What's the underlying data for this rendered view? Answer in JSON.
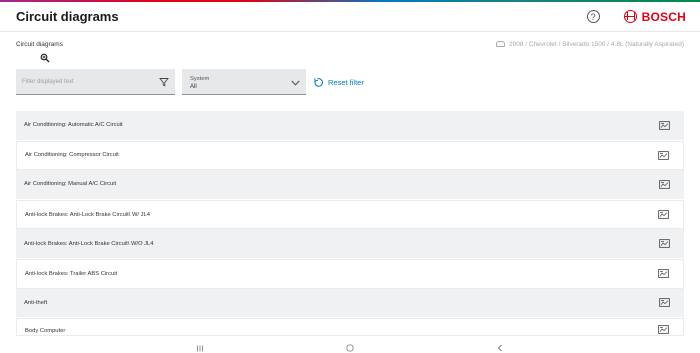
{
  "header": {
    "title": "Circuit diagrams",
    "help_glyph": "?",
    "brand": "BOSCH",
    "brand_color": "#e20015"
  },
  "breadcrumb": "Circuit diagrams",
  "vehicle": {
    "icon": "car-icon",
    "text": "2008 / Chevrolet / Silverado 1500 / 4.8L (Naturally Aspirated)"
  },
  "filter": {
    "placeholder": "Filter displayed text",
    "icon": "funnel-icon"
  },
  "system_select": {
    "label": "System",
    "value": "All"
  },
  "reset_filter": {
    "label": "Reset filter",
    "color": "#007bc0"
  },
  "diagrams": [
    {
      "label": "Air Conditioning: Automatic A/C Circuit"
    },
    {
      "label": "Air Conditioning: Compressor Circuit"
    },
    {
      "label": "Air Conditioning: Manual A/C Circuit"
    },
    {
      "label": "Anti-lock Brakes: Anti-Lock Brake Circuit\\ W/ JL4"
    },
    {
      "label": "Anti-lock Brakes: Anti-Lock Brake Circuit\\ W/O JL4"
    },
    {
      "label": "Anti-lock Brakes: Trailer ABS Circuit"
    },
    {
      "label": "Anti-theft"
    },
    {
      "label": "Body Computer"
    }
  ],
  "android_nav": [
    "recents-icon",
    "home-icon",
    "back-icon"
  ]
}
